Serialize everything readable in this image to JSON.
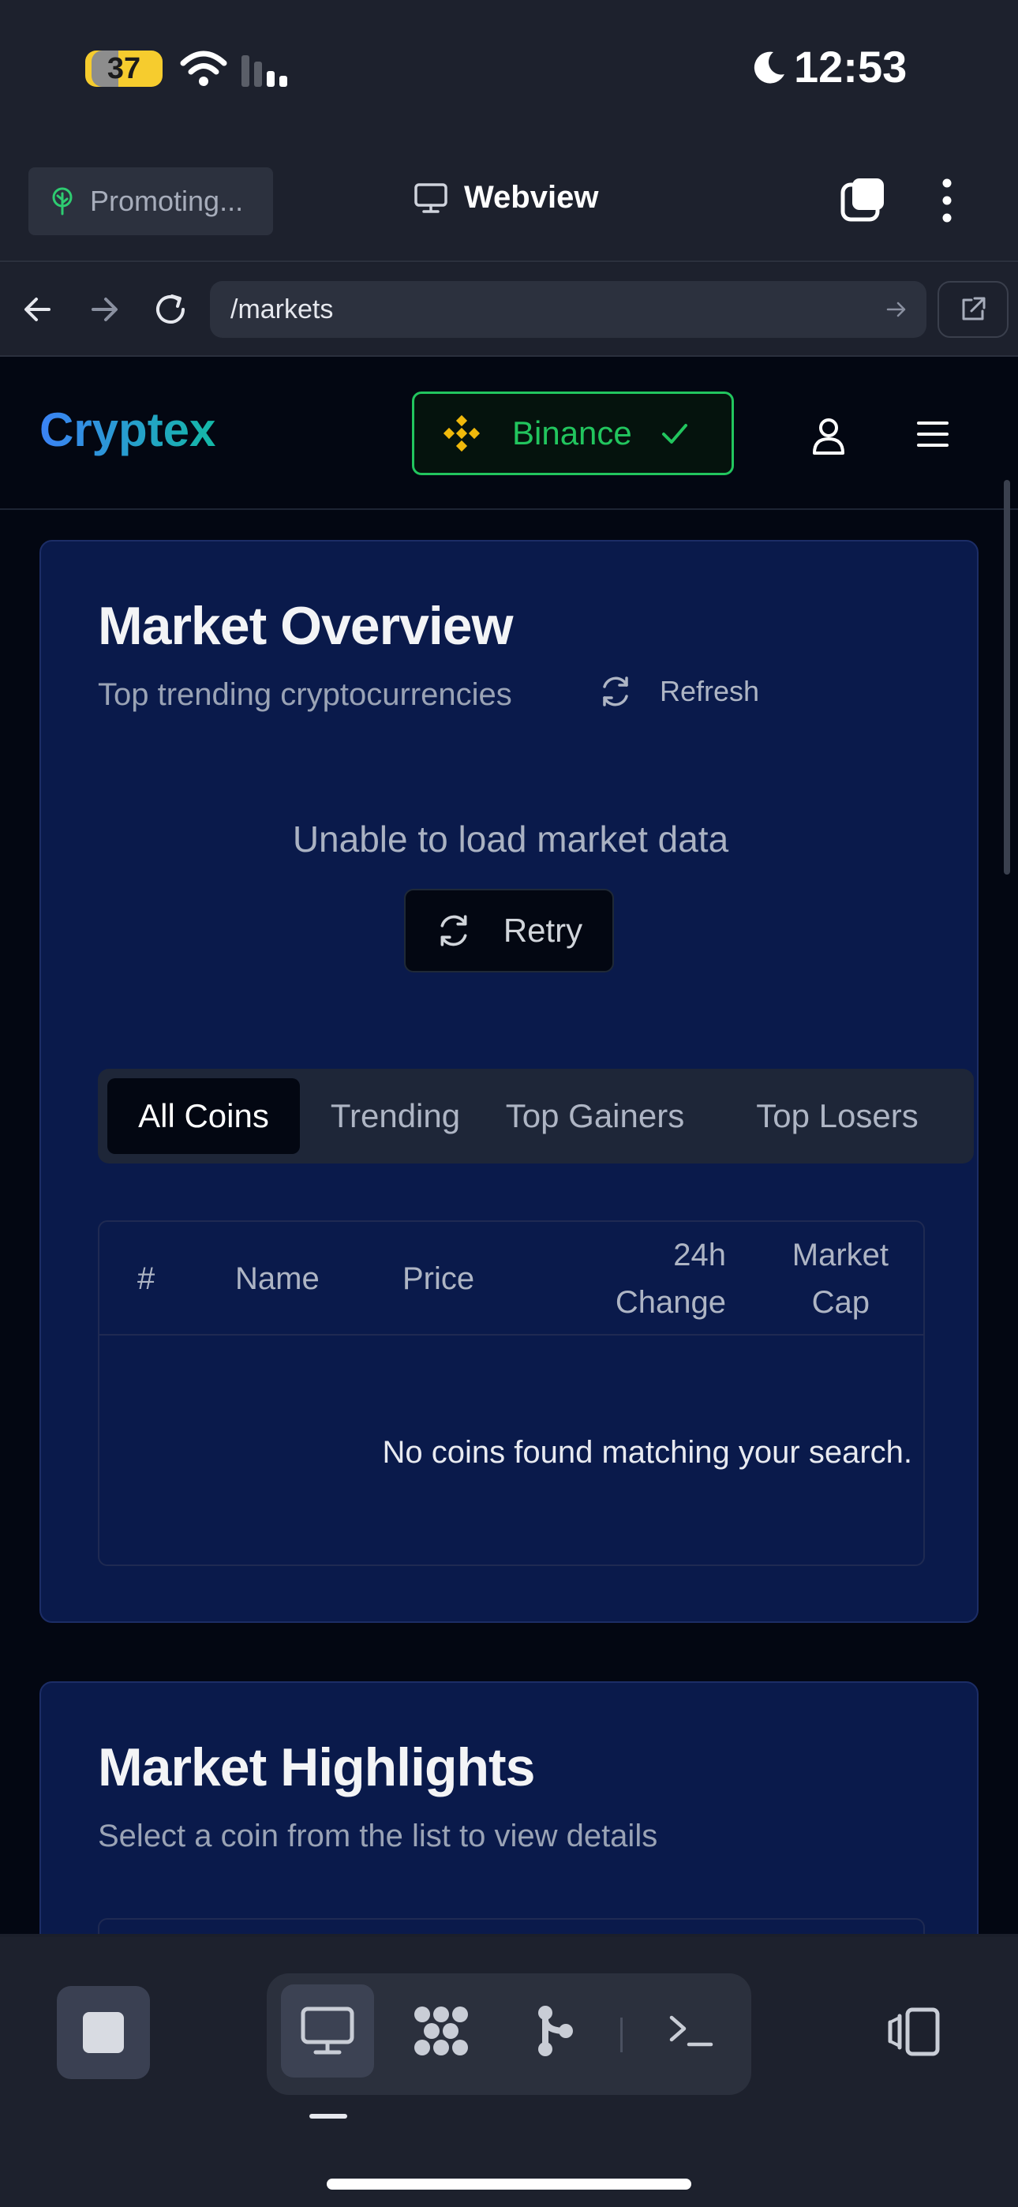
{
  "status_bar": {
    "battery": "37",
    "time": "12:53"
  },
  "browser": {
    "promo_label": "Promoting...",
    "tab_title": "Webview",
    "url": "/markets"
  },
  "site": {
    "brand": "Cryptex",
    "exchange": "Binance"
  },
  "market_overview": {
    "title": "Market Overview",
    "subtitle": "Top trending cryptocurrencies",
    "refresh_label": "Refresh",
    "error_message": "Unable to load market data",
    "retry_label": "Retry",
    "tabs": [
      {
        "label": "All Coins",
        "active": true
      },
      {
        "label": "Trending",
        "active": false
      },
      {
        "label": "Top Gainers",
        "active": false
      },
      {
        "label": "Top Losers",
        "active": false
      }
    ],
    "table": {
      "columns": [
        "#",
        "Name",
        "Price",
        "24h",
        "Change",
        "Market",
        "Cap"
      ],
      "empty_message": "No coins found matching your search."
    }
  },
  "market_highlights": {
    "title": "Market Highlights",
    "subtitle": "Select a coin from the list to view details"
  },
  "colors": {
    "accent_green": "#22c55e",
    "binance_yellow": "#f0b90b",
    "card_bg": "#0a1a4b"
  }
}
